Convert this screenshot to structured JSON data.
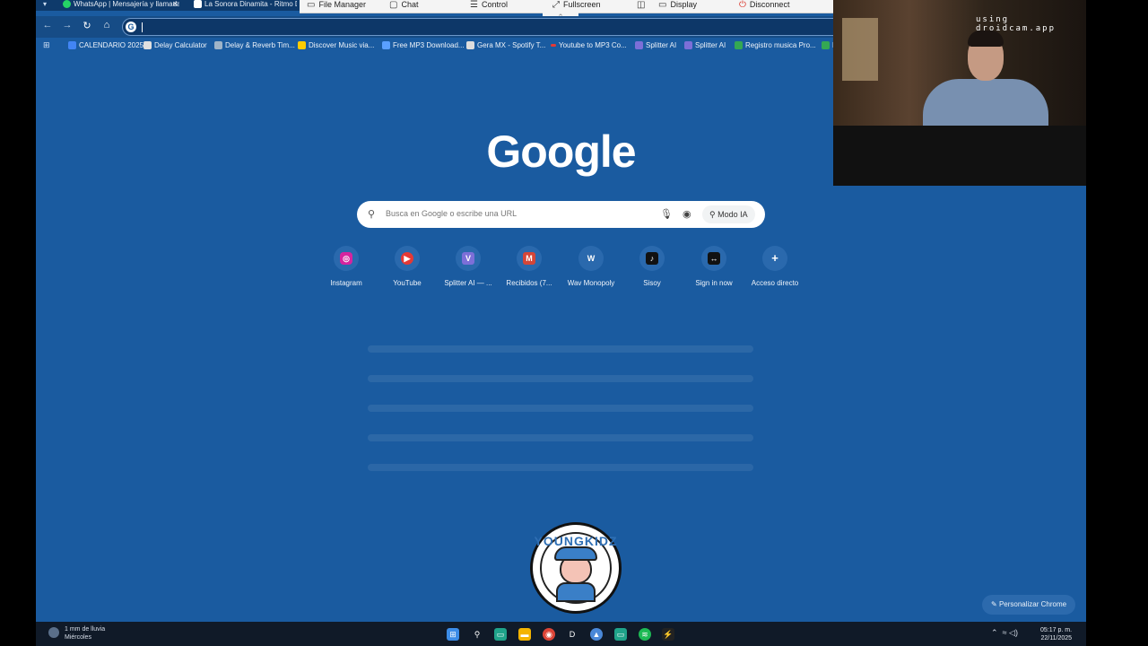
{
  "tabs": [
    {
      "label": "WhatsApp | Mensajería y llamadas",
      "color": "#25d366"
    },
    {
      "label": "La Sonora Dinamita - Ritmo De",
      "color": "#ffffff"
    }
  ],
  "tab_close": "✕",
  "remote_toolbar": {
    "file_manager": "File Manager",
    "chat": "Chat",
    "control": "Control",
    "fullscreen": "Fullscreen",
    "display": "Display",
    "disconnect": "Disconnect"
  },
  "omnibox": {
    "icon": "G",
    "value": ""
  },
  "bookmarks": [
    {
      "label": "CALENDARIO 2025",
      "color": "#4285f4"
    },
    {
      "label": "Delay Calculator",
      "color": "#e0e0e0"
    },
    {
      "label": "Delay & Reverb Tim...",
      "color": "#9fb4c8"
    },
    {
      "label": "Discover Music via...",
      "color": "#ffcc00"
    },
    {
      "label": "Free MP3 Download...",
      "color": "#5aa0ff"
    },
    {
      "label": "Gera MX - Spotify T...",
      "color": "#dddddd"
    },
    {
      "label": "Youtube to MP3 Co...",
      "color": "#e53935"
    },
    {
      "label": "Splitter AI",
      "color": "#7c6fd8"
    },
    {
      "label": "Splitter AI",
      "color": "#7c6fd8"
    },
    {
      "label": "Registro musica Pro...",
      "color": "#34a853"
    },
    {
      "label": "R",
      "color": "#34a853"
    }
  ],
  "logo": "Google",
  "search": {
    "placeholder": "Busca en Google o escribe una URL",
    "ai_mode": "Modo IA"
  },
  "shortcuts": [
    {
      "label": "Instagram",
      "color": "#d6249f",
      "glyph": "◎"
    },
    {
      "label": "YouTube",
      "color": "#e53935",
      "glyph": "▶"
    },
    {
      "label": "Splitter AI — ...",
      "color": "#7c6fd8",
      "glyph": "V"
    },
    {
      "label": "Recibidos (7...",
      "color": "#d44638",
      "glyph": "M"
    },
    {
      "label": "Wav Monopoly",
      "color": "#2a69ad",
      "glyph": "W"
    },
    {
      "label": "Sisoy",
      "color": "#111111",
      "glyph": "♪"
    },
    {
      "label": "Sign in now",
      "color": "#111111",
      "glyph": "↔"
    },
    {
      "label": "Acceso directo",
      "color": "#2a69ad",
      "glyph": "+"
    }
  ],
  "badge_text": "YOUNGKIDZ",
  "customize": "Personalizar Chrome",
  "webcam_label": "using droidcam.app",
  "taskbar": {
    "weather_line1": "1 mm de lluvia",
    "weather_line2": "Miércoles",
    "time": "05:17 p. m.",
    "date": "22/11/2025"
  }
}
